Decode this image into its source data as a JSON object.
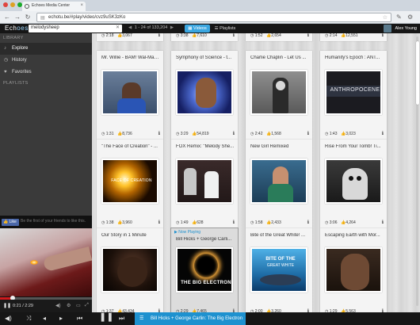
{
  "browser": {
    "tab_title": "Echoes Media Center",
    "url": "echotu.be/#play/video/cvz9uSK3zKo"
  },
  "app": {
    "logo": "Ech",
    "logo_accent": "oes",
    "search_value": "melodysheep",
    "pager_text": "1 - 24 of 133,204",
    "view_videos": "Videos",
    "view_playlists": "Playlists",
    "user_name": "Alex Young"
  },
  "sidebar": {
    "library_header": "LIBRARY",
    "items": [
      {
        "label": "Explore",
        "icon": "music-note-icon"
      },
      {
        "label": "History",
        "icon": "clock-icon"
      },
      {
        "label": "Favorites",
        "icon": "heart-icon"
      }
    ],
    "playlists_header": "PLAYLISTS"
  },
  "player": {
    "like_label": "Like",
    "like_text": "Be the first of your friends to like this.",
    "current_time": "0:21",
    "duration": "2:29",
    "time_display": "0:21 / 2:29",
    "progress": 0.14
  },
  "bottombar": {
    "now_playing_title": "Bill Hicks + George Carlin: The Big Electron"
  },
  "now_playing_label": "Now Playing",
  "cards_top": [
    {
      "duration": "2:18",
      "likes": "3,067"
    },
    {
      "duration": "3:38",
      "likes": "7,610"
    },
    {
      "duration": "1:52",
      "likes": "2,654"
    },
    {
      "duration": "2:14",
      "likes": "12,551"
    }
  ],
  "cards": [
    {
      "title": "Mr. Willie - BAM! Wal-Mart...",
      "duration": "1:31",
      "likes": "8,736",
      "art": "willie"
    },
    {
      "title": "Symphony of Science - t...",
      "duration": "3:29",
      "likes": "54,819",
      "art": "symph"
    },
    {
      "title": "Charlie Chaplin - Let Us ...",
      "duration": "2:42",
      "likes": "1,568",
      "art": "chaplin"
    },
    {
      "title": "Humanity's Epoch : ANT...",
      "duration": "1:43",
      "likes": "3,023",
      "art": "anthro",
      "art_text": "ANTHROPOCENE"
    },
    {
      "title": "\"The Face of Creation\" - ...",
      "duration": "1:38",
      "likes": "3,960",
      "art": "creation",
      "art_text": "FACE OF CREATION"
    },
    {
      "title": "FOX Remix: \"Melody She...",
      "duration": "1:49",
      "likes": "628",
      "art": "fox"
    },
    {
      "title": "New Girl Remixed",
      "duration": "1:58",
      "likes": "2,433",
      "art": "girl"
    },
    {
      "title": "Rise From Your Tomb! Ti...",
      "duration": "3:06",
      "likes": "4,264",
      "art": "tomb"
    },
    {
      "title": "Our Story in 1 Minute",
      "duration": "1:37",
      "likes": "43,434",
      "art": "story"
    },
    {
      "title": "Bill Hicks + George Carli...",
      "duration": "2:29",
      "likes": "7,465",
      "art": "bigelectron",
      "art_text": "THE BIG ELECTRON",
      "playing": true
    },
    {
      "title": "Bite of the Great White! ...",
      "duration": "2:00",
      "likes": "3,260",
      "art": "white",
      "art_text": "BITE OF THE",
      "art_text2": "GREAT WHITE"
    },
    {
      "title": "Escaping Earth with Mor...",
      "duration": "1:29",
      "likes": "5,563",
      "art": "earth"
    }
  ],
  "colors": {
    "accent": "#1e91cf",
    "videos_button": "#3aa6e0",
    "progress": "#d0191d",
    "like_button": "#4a67a8"
  }
}
